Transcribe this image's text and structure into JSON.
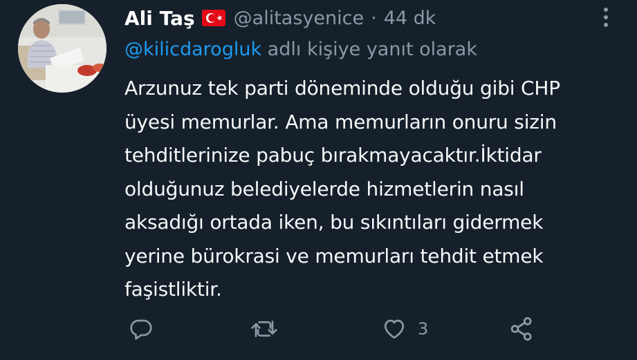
{
  "tweet": {
    "author_name": "Ali Taş",
    "flag_icon": "turkey-flag-icon",
    "handle": "@alitasyenice",
    "separator": "·",
    "time": "44 dk",
    "reply_to": {
      "mention": "@kilicdarogluk",
      "suffix": " adlı kişiye yanıt olarak"
    },
    "text": "Arzunuz tek parti döneminde olduğu gibi CHP\nüyesi memurlar. Ama memurların onuru sizin\ntehditlerinize pabuç bırakmayacaktır.İktidar\nolduğunuz belediyelerde hizmetlerin nasıl\naksadığı ortada iken, bu sıkıntıları gidermek\nyerine bürokrasi ve memurları tehdit etmek\nfaşistliktir.",
    "actions": {
      "reply_icon": "reply-icon",
      "retweet_icon": "retweet-icon",
      "like_icon": "heart-icon",
      "like_count": "3",
      "share_icon": "share-icon"
    }
  },
  "colors": {
    "background": "#15202b",
    "primary_text": "#f7f9f9",
    "secondary_text": "#8b98a5",
    "link": "#1d9bf0",
    "flag_red": "#e30a17"
  }
}
